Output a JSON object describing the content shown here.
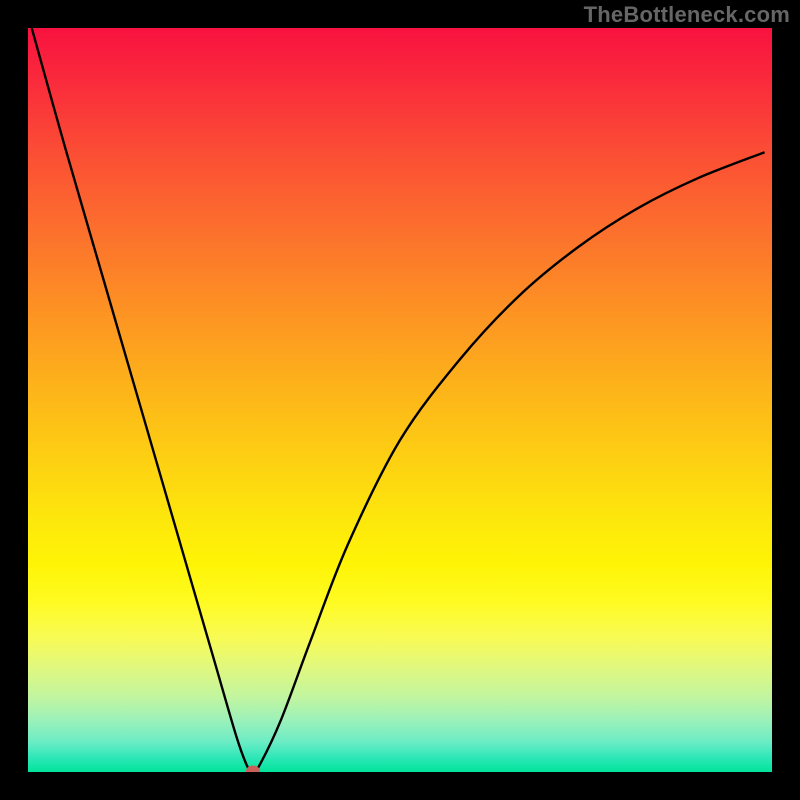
{
  "watermark": "TheBottleneck.com",
  "colors": {
    "frame_background": "#000000",
    "curve_stroke": "#000000",
    "marker_fill": "#c9605a",
    "watermark_text": "#666666",
    "gradient_stops": [
      "#f8123f",
      "#fa2a3c",
      "#fb4b35",
      "#fc6c2e",
      "#fd8f24",
      "#fdb21a",
      "#fdd012",
      "#fde70c",
      "#fef406",
      "#fffb21",
      "#f8fb55",
      "#e0f87f",
      "#c1f5a0",
      "#9cf1b9",
      "#6becc5",
      "#2fe7b8",
      "#00e49a"
    ]
  },
  "chart_data": {
    "type": "line",
    "title": "",
    "xlabel": "",
    "ylabel": "",
    "xlim": [
      0,
      1
    ],
    "ylim": [
      0,
      1
    ],
    "notes": "V-shaped bottleneck curve over red→green vertical gradient. No axis ticks or numeric labels are visible; values below are normalized fractions of the 744×744 plot area (x right, y up).",
    "series": [
      {
        "name": "bottleneck-curve",
        "x": [
          0.005,
          0.05,
          0.1,
          0.15,
          0.2,
          0.25,
          0.28,
          0.295,
          0.302,
          0.31,
          0.34,
          0.38,
          0.43,
          0.5,
          0.58,
          0.66,
          0.74,
          0.82,
          0.9,
          0.99
        ],
        "y": [
          1.0,
          0.839,
          0.667,
          0.495,
          0.323,
          0.151,
          0.048,
          0.007,
          0.001,
          0.007,
          0.07,
          0.177,
          0.306,
          0.446,
          0.554,
          0.64,
          0.706,
          0.758,
          0.798,
          0.833
        ]
      }
    ],
    "marker": {
      "x": 0.302,
      "y": 0.001,
      "name": "minimum-point"
    }
  }
}
